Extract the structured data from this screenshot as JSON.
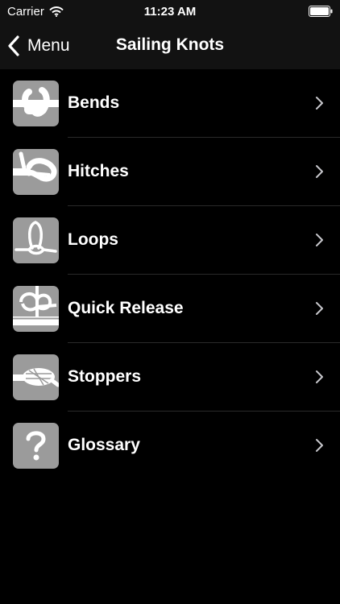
{
  "status_bar": {
    "carrier": "Carrier",
    "time": "11:23 AM"
  },
  "nav": {
    "back_label": "Menu",
    "title": "Sailing Knots"
  },
  "items": [
    {
      "label": "Bends",
      "icon": "bend-knot-icon"
    },
    {
      "label": "Hitches",
      "icon": "hitch-knot-icon"
    },
    {
      "label": "Loops",
      "icon": "loop-knot-icon"
    },
    {
      "label": "Quick Release",
      "icon": "quick-release-knot-icon"
    },
    {
      "label": "Stoppers",
      "icon": "stopper-knot-icon"
    },
    {
      "label": "Glossary",
      "icon": "question-mark-icon"
    }
  ],
  "colors": {
    "background": "#000000",
    "bar": "#121212",
    "thumb": "#9b9b9b",
    "text": "#ffffff"
  }
}
